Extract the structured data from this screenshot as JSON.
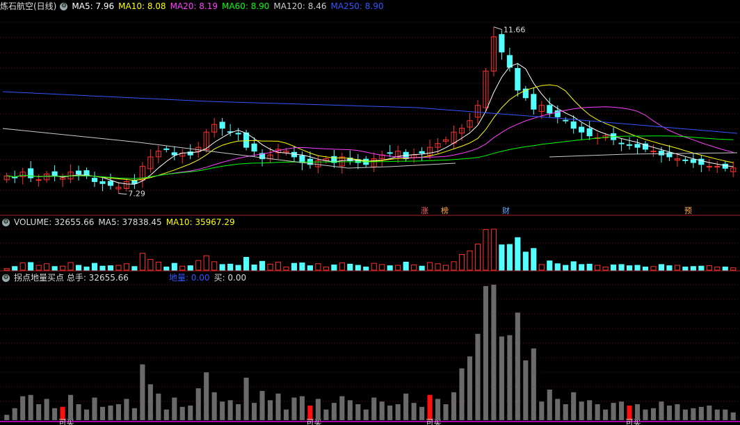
{
  "main": {
    "title": "炼石航空(日线)",
    "ma": [
      {
        "label": "MA5: 7.96",
        "color": "#ffffff"
      },
      {
        "label": "MA10: 8.08",
        "color": "#ffff00"
      },
      {
        "label": "MA20: 8.19",
        "color": "#ff40ff"
      },
      {
        "label": "MA60: 8.90",
        "color": "#00ff00"
      },
      {
        "label": "MA120: 8.46",
        "color": "#cccccc"
      },
      {
        "label": "MA250: 8.90",
        "color": "#3355ff"
      }
    ],
    "high_label": "11.66",
    "low_label": "7.29",
    "tags": [
      {
        "text": "涨",
        "color": "#ff6666"
      },
      {
        "text": "榜",
        "color": "#ffaa44"
      },
      {
        "text": "财",
        "color": "#66aaff"
      },
      {
        "text": "预",
        "color": "#ffaa44"
      }
    ]
  },
  "volume": {
    "label": "VOLUME: 32655.66",
    "ma5": "MA5: 37838.45",
    "ma10": "MA10: 35967.29"
  },
  "indicator": {
    "title": "拐点地量买点 总手: 32655.66",
    "diliang": "地量: 0.00",
    "mai": "买: 0.00",
    "buy_label": "可买"
  },
  "chart_data": {
    "type": "candlestick",
    "y_range": [
      6.9,
      12.0
    ],
    "high": 11.66,
    "low": 7.29,
    "close_values": [
      7.75,
      7.7,
      7.85,
      7.7,
      7.65,
      7.8,
      7.75,
      7.7,
      7.85,
      7.8,
      7.75,
      7.6,
      7.55,
      7.5,
      7.45,
      7.6,
      7.55,
      8.0,
      8.25,
      8.4,
      8.45,
      8.3,
      8.35,
      8.3,
      8.5,
      8.9,
      9.1,
      9.0,
      8.9,
      8.85,
      8.5,
      8.4,
      8.2,
      8.3,
      8.45,
      8.4,
      8.25,
      8.1,
      8.05,
      8.15,
      8.2,
      8.1,
      8.25,
      8.15,
      8.1,
      8.05,
      8.2,
      8.3,
      8.35,
      8.4,
      8.2,
      8.3,
      8.35,
      8.5,
      8.6,
      8.7,
      8.9,
      9.0,
      9.2,
      9.6,
      10.5,
      11.4,
      11.0,
      10.6,
      10.0,
      9.8,
      9.5,
      9.6,
      9.4,
      9.3,
      9.2,
      9.0,
      8.9,
      8.8,
      8.75,
      8.8,
      8.7,
      8.6,
      8.55,
      8.5,
      8.45,
      8.4,
      8.3,
      8.25,
      8.2,
      8.15,
      8.1,
      8.05,
      8.0,
      8.0,
      7.95,
      7.96
    ],
    "buy_signals": [
      7,
      38,
      53,
      78
    ]
  }
}
